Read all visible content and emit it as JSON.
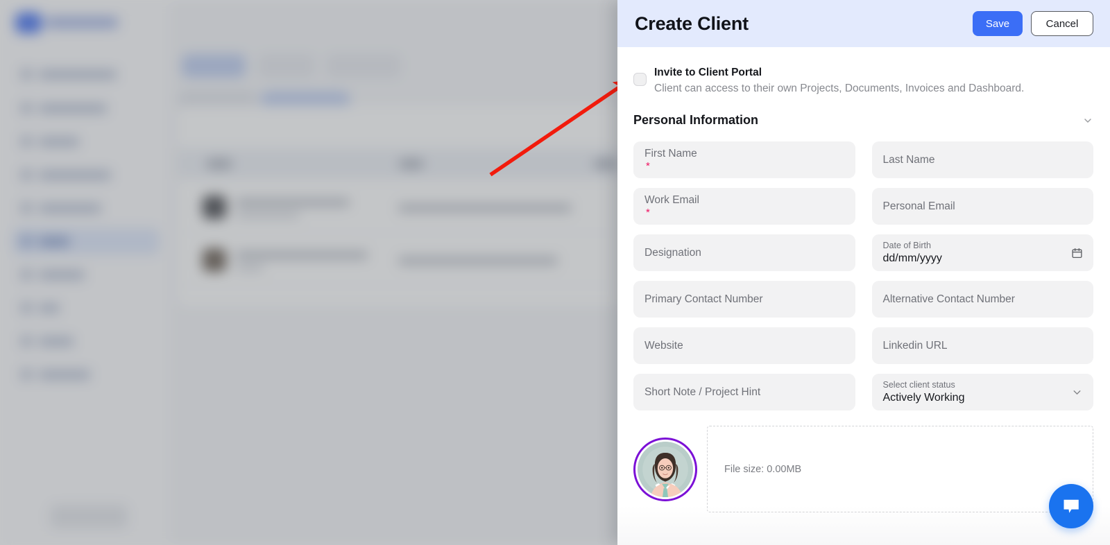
{
  "panel": {
    "title": "Create Client",
    "save_label": "Save",
    "cancel_label": "Cancel"
  },
  "invite": {
    "title": "Invite to Client Portal",
    "description": "Client can access to their own Projects, Documents, Invoices and Dashboard.",
    "checked": false
  },
  "section": {
    "title": "Personal Information",
    "collapse_icon": "chevron-down-icon"
  },
  "fields": {
    "first_name": {
      "placeholder": "First Name",
      "required": true,
      "value": ""
    },
    "last_name": {
      "placeholder": "Last Name",
      "required": false,
      "value": ""
    },
    "work_email": {
      "placeholder": "Work Email",
      "required": true,
      "value": ""
    },
    "personal_email": {
      "placeholder": "Personal Email",
      "required": false,
      "value": ""
    },
    "designation": {
      "placeholder": "Designation",
      "required": false,
      "value": ""
    },
    "date_of_birth": {
      "label": "Date of Birth",
      "value": "dd/mm/yyyy",
      "icon": "calendar-icon"
    },
    "primary_contact": {
      "placeholder": "Primary Contact Number",
      "required": false,
      "value": ""
    },
    "alternative_contact": {
      "placeholder": "Alternative Contact Number",
      "required": false,
      "value": ""
    },
    "website": {
      "placeholder": "Website",
      "required": false,
      "value": ""
    },
    "linkedin_url": {
      "placeholder": "Linkedin URL",
      "required": false,
      "value": ""
    },
    "short_note": {
      "placeholder": "Short Note / Project Hint",
      "required": false,
      "value": ""
    },
    "client_status": {
      "label": "Select client status",
      "value": "Actively Working",
      "icon": "chevron-down-icon"
    }
  },
  "upload": {
    "avatar_alt": "client-avatar-illustration",
    "file_size_label": "File size: 0.00MB"
  },
  "chat_widget": {
    "icon": "chat-bubble-icon"
  },
  "annotation": {
    "type": "arrow",
    "color": "#f21b0c"
  },
  "colors": {
    "accent_blue": "#3b6ef6",
    "header_bg": "#e3eafd",
    "field_bg": "#f2f2f3",
    "required_mark": "#ef1260",
    "avatar_ring": "#7b10d6",
    "chat_fab": "#1a73ef",
    "annotation_red": "#f21b0c"
  }
}
